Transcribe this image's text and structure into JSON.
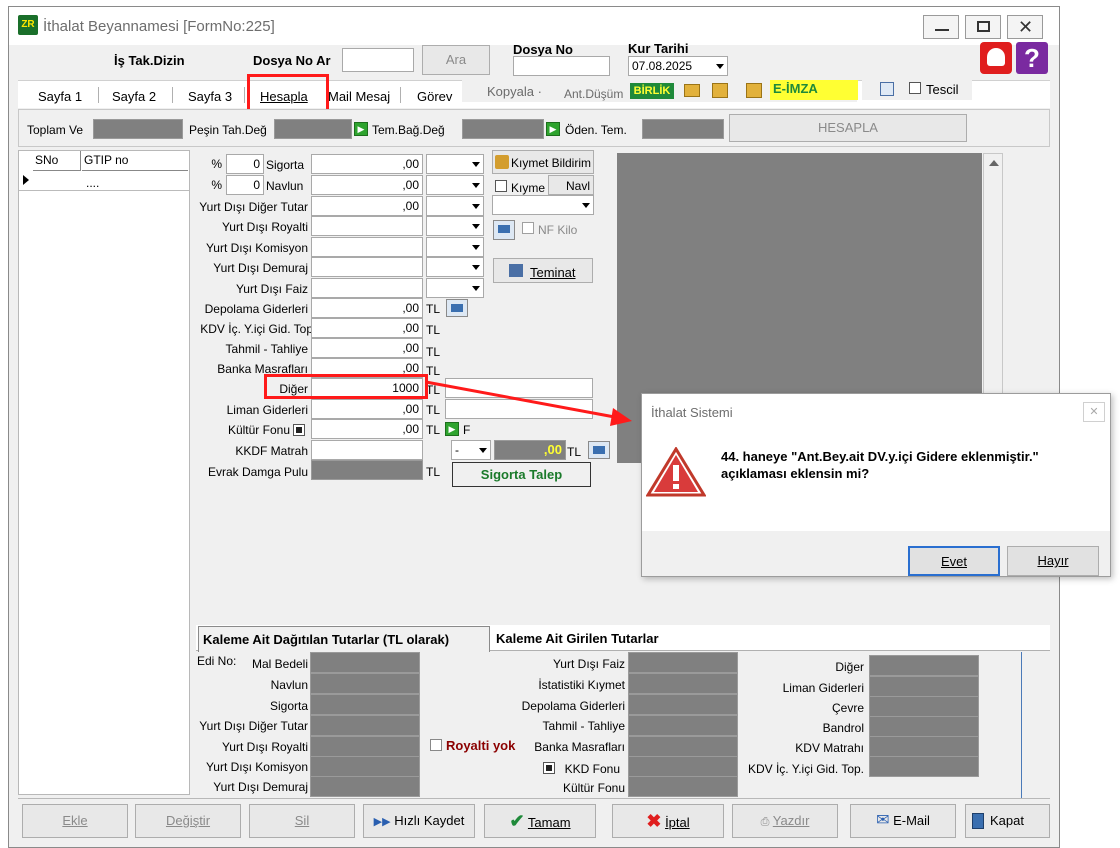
{
  "window": {
    "title": "İthalat Beyannamesi [FormNo:225]"
  },
  "header": {
    "is_takip_label": "İş Tak.Dizin",
    "dosya_no_ara_label": "Dosya No Ar",
    "ara_button": "Ara",
    "dosya_no_label": "Dosya No",
    "kur_tarihi_label": "Kur Tarihi",
    "kur_tarihi_value": "07.08.2025"
  },
  "tabs": {
    "sayfa1": "Sayfa 1",
    "sayfa2": "Sayfa 2",
    "sayfa3": "Sayfa 3",
    "hesapla": "Hesapla",
    "mail": "Mail Mesaj",
    "gorev": "Görev",
    "kopyala": "Kopyala ·",
    "ant_dusum": "Ant.Düşüm",
    "birlik": "BİRLİK",
    "e_imza": "E-İMZA",
    "tescil": "Tescil"
  },
  "summary": {
    "toplam_ve": "Toplam Ve",
    "pesin_tah": "Peşin Tah.Değ",
    "tem_bag": "Tem.Bağ.Değ",
    "oden_tem": "Öden. Tem.",
    "hesapla_button": "HESAPLA"
  },
  "grid": {
    "col_sno": "SNo",
    "col_gtip": "GTIP no",
    "row1_gtip": "...."
  },
  "form": {
    "percent": "%",
    "sigorta_pct": "0",
    "navlun_pct": "0",
    "sigorta": "Sigorta",
    "navlun": "Navlun",
    "yd_diger_tutar": "Yurt Dışı Diğer Tutar",
    "yd_royalti": "Yurt Dışı Royalti",
    "yd_komisyon": "Yurt Dışı Komisyon",
    "yd_demuraj": "Yurt Dışı Demuraj",
    "yd_faiz": "Yurt Dışı Faiz",
    "depolama": "Depolama Giderleri",
    "kdv_ic": "KDV İç. Y.içi Gid. Top",
    "tahmil": "Tahmil - Tahliye",
    "banka": "Banka Masrafları",
    "diger": "Diğer",
    "liman": "Liman Giderleri",
    "kultur": "Kültür Fonu",
    "kkdf_matrah": "KKDF Matrah",
    "evrak_damga": "Evrak Damga Pulu",
    "zero": ",00",
    "diger_value": "1000",
    "tl": "TL",
    "kkdf_value": ",00",
    "dash": "-",
    "kultur_suffix": "F",
    "kiymet_bildirim": "Kıymet Bildirim",
    "kiyme": "Kıyme",
    "navl": "Navl",
    "nf_kilo": "NF Kilo",
    "teminat": "Teminat",
    "sigorta_talep": "Sigorta Talep"
  },
  "bottom_tabs": {
    "tab1": "Kaleme Ait Dağıtılan Tutarlar (TL olarak)",
    "tab2": "Kaleme Ait Girilen Tutarlar"
  },
  "bottom": {
    "edi_no": "Edi No:",
    "mal_bedeli": "Mal Bedeli",
    "navlun": "Navlun",
    "sigorta": "Sigorta",
    "yd_diger": "Yurt Dışı Diğer Tutar",
    "yd_royalti": "Yurt Dışı Royalti",
    "yd_komisyon": "Yurt Dışı Komisyon",
    "yd_demuraj": "Yurt Dışı Demuraj",
    "yd_faiz": "Yurt Dışı Faiz",
    "istatistiki": "İstatistiki Kıymet",
    "depolama": "Depolama Giderleri",
    "tahmil": "Tahmil - Tahliye",
    "banka": "Banka Masrafları",
    "kkd_fonu": "KKD Fonu",
    "kultur_fonu": "Kültür Fonu",
    "royalti_yok": "Royalti yok",
    "diger": "Diğer",
    "liman": "Liman Giderleri",
    "cevre": "Çevre",
    "bandrol": "Bandrol",
    "kdv_matrahi": "KDV Matrahı",
    "kdv_ic": "KDV İç. Y.içi Gid. Top."
  },
  "toolbar": {
    "ekle": "Ekle",
    "degistir": "Değiştir",
    "sil": "Sil",
    "hizli_kaydet": "Hızlı Kaydet",
    "tamam": "Tamam",
    "iptal": "İptal",
    "yazdir": "Yazdır",
    "email": "E-Mail",
    "kapat": "Kapat"
  },
  "dialog": {
    "title": "İthalat Sistemi",
    "message_line1": "44. haneye  \"Ant.Bey.ait DV.y.içi Gidere eklenmiştir.\"",
    "message_line2": "açıklaması eklensin mi?",
    "yes": "Evet",
    "no": "Hayır"
  },
  "colors": {
    "annotation_red": "#ff1a1a",
    "birlik_bg": "#1f8a3a",
    "eimza_bg": "#ffff33",
    "gray_field": "#808080"
  }
}
